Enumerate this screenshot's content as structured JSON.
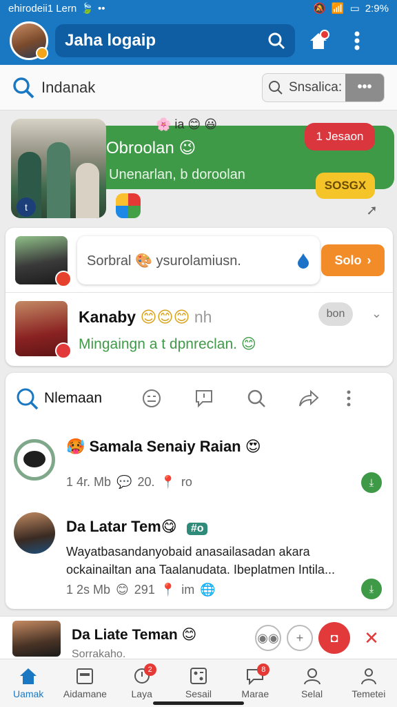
{
  "status_bar": {
    "left_text": "ehirodeii1 Lern",
    "time": "2:9%"
  },
  "app_bar": {
    "title": "Jaha logaip"
  },
  "search_strip": {
    "label": "Indanak",
    "search_placeholder": "Snsalica:",
    "more_label": "•••"
  },
  "promo": {
    "title": "Obroolan 😉",
    "subtitle": "Unenarlan, b doroolan",
    "top_emojis": "🌸 ia 😊 😃",
    "red_pill": "1 Jesaon",
    "yellow_pill": "SOSGX"
  },
  "composer": {
    "placeholder": "Sorbral 🎨 ysurolamiusn.",
    "send_label": "Solo"
  },
  "contact_row": {
    "name": "Kanaby",
    "emojis": "😊😊😊",
    "suffix": "nh",
    "message": "Mingaingn a t dpnreclan. 😊",
    "pill": "bon"
  },
  "feed": {
    "tab_label": "Nlemaan",
    "posts": [
      {
        "title": "🥵 Samala Senaiy Raian 😍",
        "meta_time": "1 4r. Mb",
        "meta_count": "20.",
        "meta_extra": "ro"
      },
      {
        "title": "Da Latar Tem😋",
        "tag": "#o",
        "body_line1": "Wayatbasandanyobaid anasailasadan akara",
        "body_line2": "ockainailtan ana Taalanudata. Ibeplatmen Intila...",
        "meta_time": "1 2s Mb",
        "meta_count": "291",
        "meta_extra": "im"
      }
    ]
  },
  "mini_bar": {
    "name": "Da Liate Teman 😊",
    "sub": "Sorrakaho."
  },
  "bottom_nav": [
    {
      "label": "Uamak",
      "icon": "home-icon",
      "active": true
    },
    {
      "label": "Aidamane",
      "icon": "calendar-icon",
      "active": false
    },
    {
      "label": "Laya",
      "icon": "notification-icon",
      "badge": "2",
      "active": false
    },
    {
      "label": "Sesail",
      "icon": "grid-icon",
      "active": false
    },
    {
      "label": "Marae",
      "icon": "chat-icon",
      "badge": "8",
      "active": false
    },
    {
      "label": "Selal",
      "icon": "profile-icon",
      "active": false
    },
    {
      "label": "Temetei",
      "icon": "person-icon",
      "active": false
    }
  ],
  "colors": {
    "primary": "#1a78c2",
    "green": "#3e9a46",
    "red": "#d9363e",
    "orange": "#f28c28",
    "yellow": "#f4c429"
  }
}
